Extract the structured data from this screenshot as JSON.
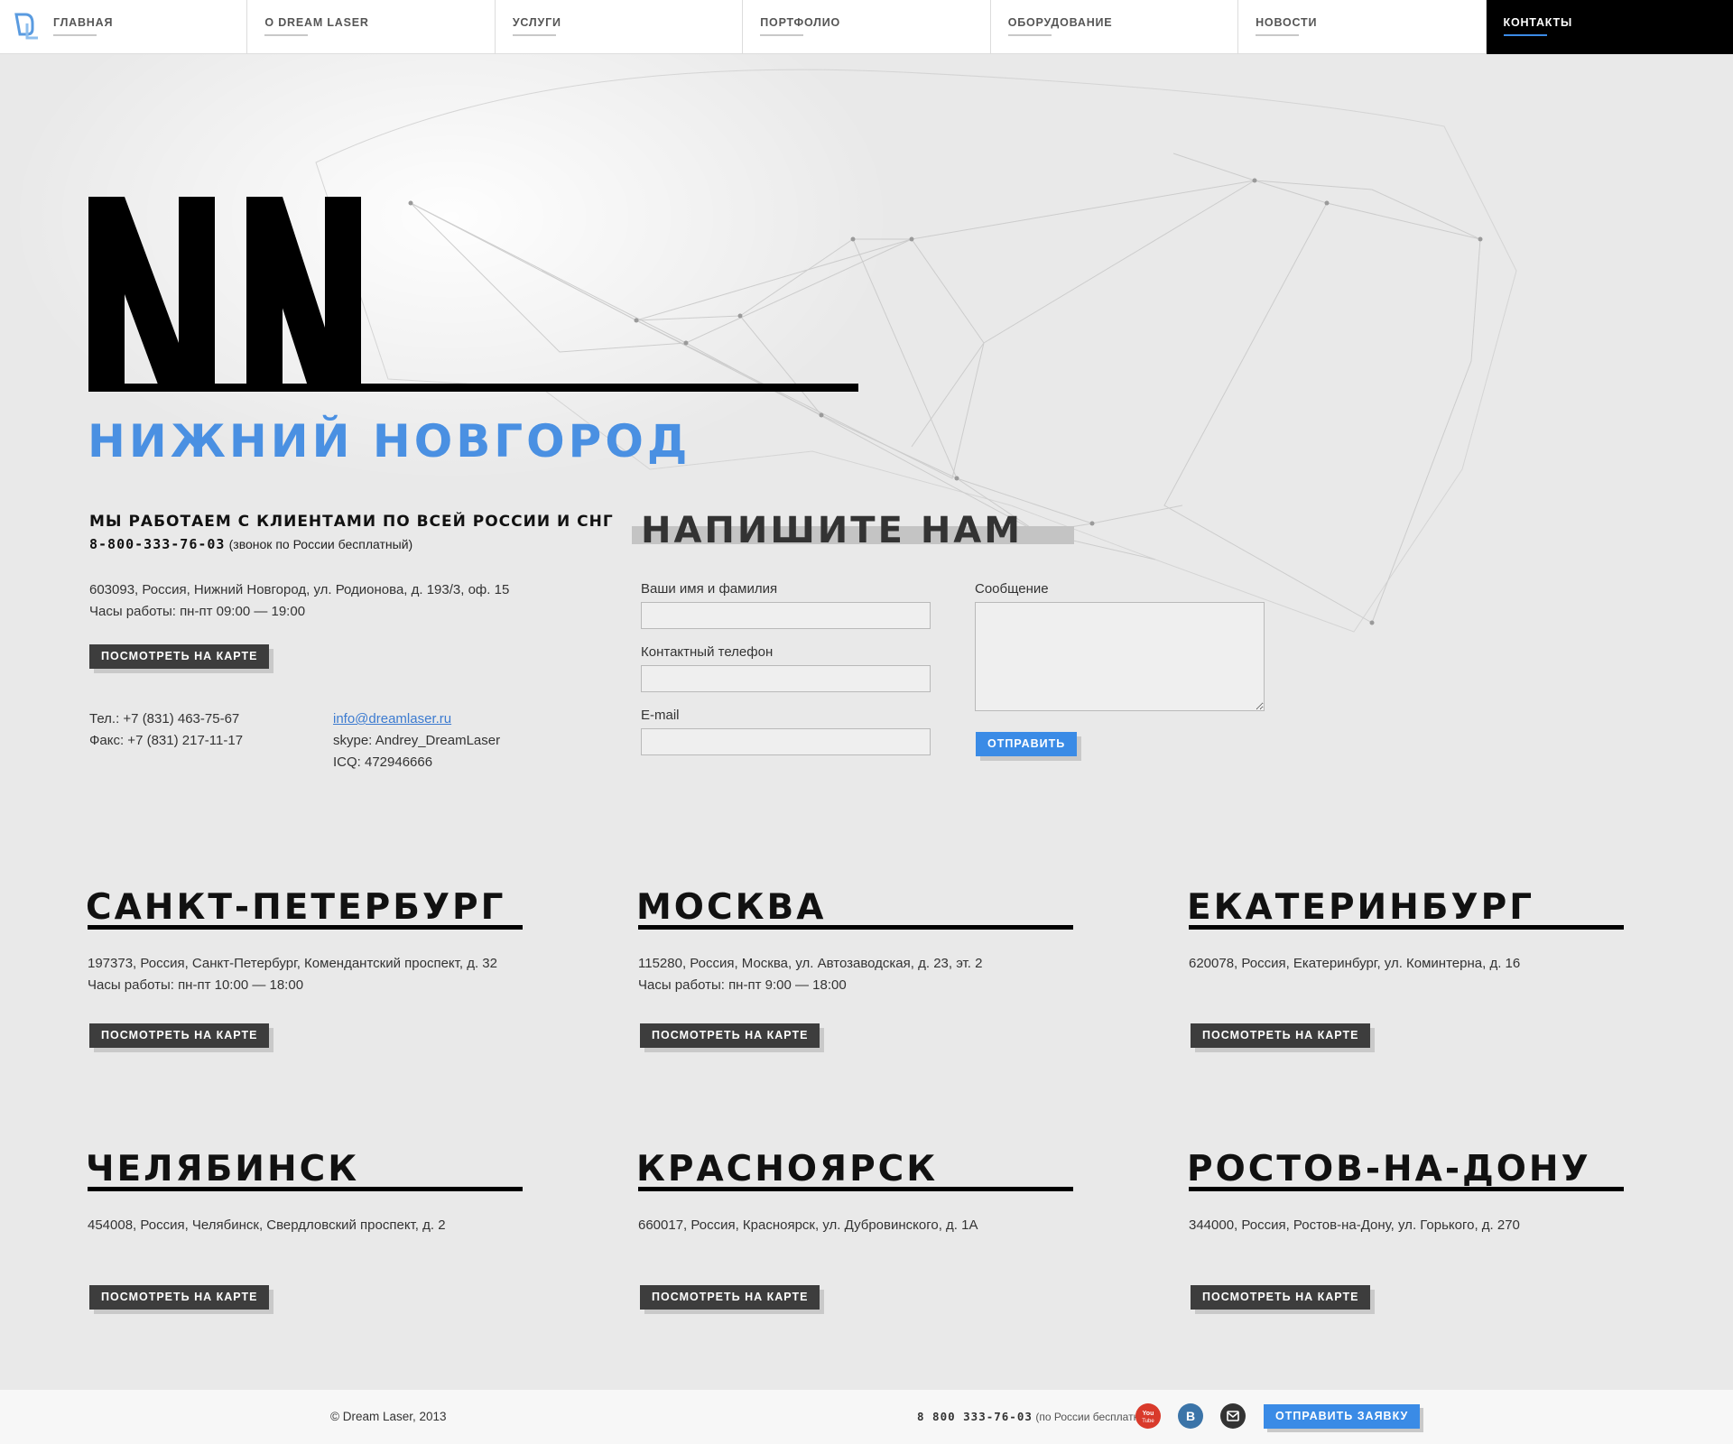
{
  "nav": {
    "items": [
      {
        "label": "Главная"
      },
      {
        "label": "О Dream Laser"
      },
      {
        "label": "Услуги"
      },
      {
        "label": "Портфолио"
      },
      {
        "label": "Оборудование"
      },
      {
        "label": "Новости"
      },
      {
        "label": "Контакты"
      }
    ],
    "active_index": 6,
    "accent": "#3c8be6"
  },
  "hero": {
    "city_code": "NN",
    "city_name": "НИЖНИЙ НОВГОРОД",
    "city_color": "#4a90e2"
  },
  "main_office": {
    "heading": "МЫ РАБОТАЕМ С КЛИЕНТАМИ ПО ВСЕЙ РОССИИ И СНГ",
    "phone": "8-800-333-76-03",
    "phone_note": "(звонок по России бесплатный)",
    "address": "603093, Россия, Нижний Новгород, ул. Родионова, д. 193/3, оф. 15",
    "hours": "Часы работы: пн-пт 09:00 — 19:00",
    "map_button": "ПОСМОТРЕТЬ НА КАРТЕ",
    "tel": "Тел.: +7 (831) 463-75-67",
    "fax": "Факс: +7 (831) 217-11-17",
    "email": "info@dreamlaser.ru",
    "skype": "skype: Andrey_DreamLaser",
    "icq": "ICQ: 472946666"
  },
  "form": {
    "title": "НАПИШИТЕ НАМ",
    "name_label": "Ваши имя и фамилия",
    "phone_label": "Контактный телефон",
    "email_label": "E-mail",
    "message_label": "Сообщение",
    "submit": "ОТПРАВИТЬ",
    "name_value": "",
    "phone_value": "",
    "email_value": "",
    "message_value": ""
  },
  "branches": [
    {
      "name": "САНКТ-ПЕТЕРБУРГ",
      "address": "197373, Россия, Санкт-Петербург, Комендантский проспект, д. 32",
      "hours": "Часы работы: пн-пт 10:00 — 18:00",
      "button": "ПОСМОТРЕТЬ НА КАРТЕ"
    },
    {
      "name": "МОСКВА",
      "address": "115280, Россия, Москва, ул. Автозаводская, д. 23, эт. 2",
      "hours": "Часы работы: пн-пт 9:00 — 18:00",
      "button": "ПОСМОТРЕТЬ НА КАРТЕ"
    },
    {
      "name": "ЕКАТЕРИНБУРГ",
      "address": "620078, Россия,  Екатеринбург, ул. Коминтерна, д. 16",
      "hours": "",
      "button": "ПОСМОТРЕТЬ НА КАРТЕ"
    },
    {
      "name": "ЧЕЛЯБИНСК",
      "address": "454008, Россия, Челябинск, Свердловский проспект, д. 2",
      "hours": "",
      "button": "ПОСМОТРЕТЬ НА КАРТЕ"
    },
    {
      "name": "КРАСНОЯРСК",
      "address": "660017, Россия, Красноярск, ул. Дубровинского, д. 1А",
      "hours": "",
      "button": "ПОСМОТРЕТЬ НА КАРТЕ"
    },
    {
      "name": "РОСТОВ-НА-ДОНУ",
      "address": "344000, Россия, Ростов-на-Дону, ул. Горького, д. 270",
      "hours": "",
      "button": "ПОСМОТРЕТЬ НА КАРТЕ"
    }
  ],
  "footer": {
    "copyright": "© Dream Laser, 2013",
    "phone": "8 800 333-76-03",
    "phone_note": "(по России бесплатно)",
    "order_button": "ОТПРАВИТЬ ЗАЯВКУ",
    "socials": [
      {
        "icon": "youtube-icon",
        "color": "#d93a2b"
      },
      {
        "icon": "vk-icon",
        "color": "#3b74a8"
      },
      {
        "icon": "mail-icon",
        "color": "#333333"
      }
    ]
  }
}
